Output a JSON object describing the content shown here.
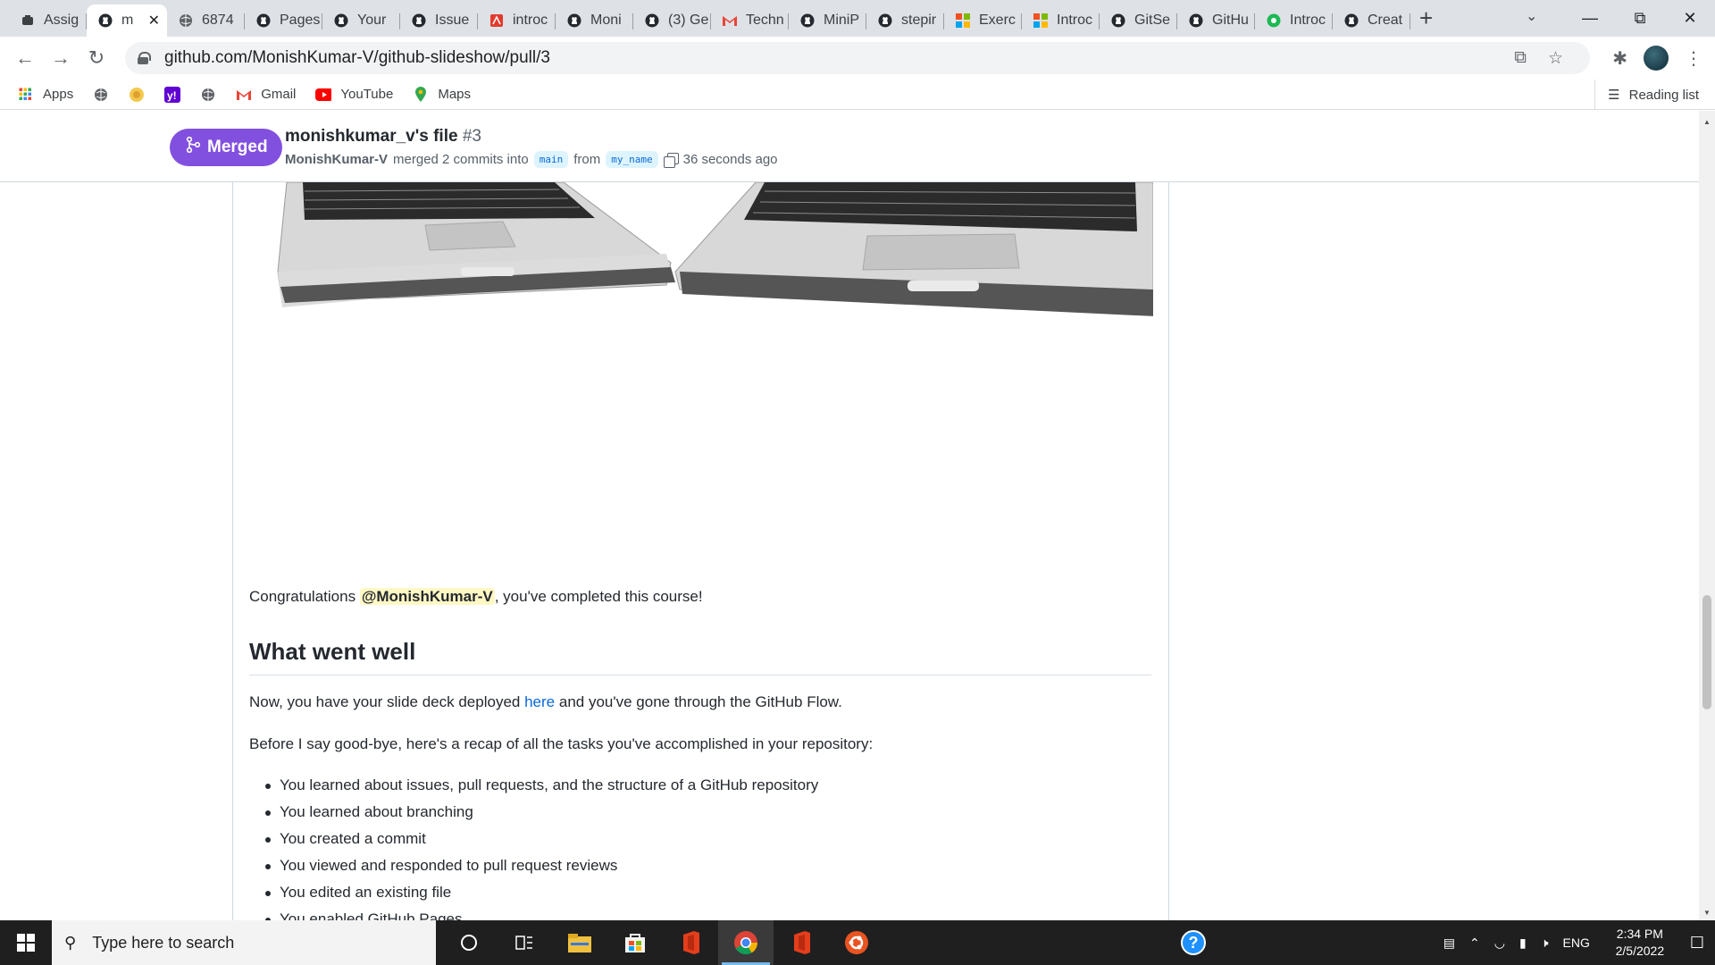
{
  "browser": {
    "tabs": [
      {
        "label": "Assig",
        "icon": "generic-app-icon"
      },
      {
        "label": "m",
        "icon": "github-icon",
        "active": true
      },
      {
        "label": "6874",
        "icon": "globe-icon"
      },
      {
        "label": "Pages",
        "icon": "github-icon"
      },
      {
        "label": "Your",
        "icon": "github-icon"
      },
      {
        "label": "Issue",
        "icon": "github-icon"
      },
      {
        "label": "introc",
        "icon": "pdf-icon"
      },
      {
        "label": "Moni",
        "icon": "github-icon"
      },
      {
        "label": "(3) Ge",
        "icon": "github-icon"
      },
      {
        "label": "Techn",
        "icon": "gmail-icon"
      },
      {
        "label": "MiniP",
        "icon": "github-icon"
      },
      {
        "label": "stepir",
        "icon": "github-icon"
      },
      {
        "label": "Exerc",
        "icon": "microsoft-icon"
      },
      {
        "label": "Introc",
        "icon": "microsoft-icon"
      },
      {
        "label": "GitSe",
        "icon": "github-icon"
      },
      {
        "label": "GitHu",
        "icon": "github-icon"
      },
      {
        "label": "Introc",
        "icon": "green-app-icon"
      },
      {
        "label": "Creat",
        "icon": "github-icon"
      }
    ],
    "new_tab": "+",
    "url": "github.com/MonishKumar-V/github-slideshow/pull/3",
    "bookmarks": [
      {
        "label": "Apps",
        "icon": "apps-grid-icon"
      },
      {
        "label": "",
        "icon": "globe-icon"
      },
      {
        "label": "",
        "icon": "emblem-icon"
      },
      {
        "label": "",
        "icon": "yahoo-icon"
      },
      {
        "label": "",
        "icon": "globe-icon"
      },
      {
        "label": "Gmail",
        "icon": "gmail-icon"
      },
      {
        "label": "YouTube",
        "icon": "youtube-icon"
      },
      {
        "label": "Maps",
        "icon": "maps-icon"
      }
    ],
    "reading_list": "Reading list"
  },
  "pr": {
    "status": "Merged",
    "title": "monishkumar_v's file",
    "number": "#3",
    "author": "MonishKumar-V",
    "merged_text": "merged 2 commits into",
    "base_branch": "main",
    "from_text": "from",
    "head_branch": "my_name",
    "time_ago": "36 seconds ago"
  },
  "comment": {
    "congrats_prefix": "Congratulations",
    "mention": "@MonishKumar-V",
    "congrats_suffix": ", you've completed this course!",
    "heading": "What went well",
    "para1_prefix": "Now, you have your slide deck deployed",
    "para1_link": "here",
    "para1_suffix": "and you've gone through the GitHub Flow.",
    "para2": "Before I say good-bye, here's a recap of all the tasks you've accomplished in your repository:",
    "tasks": [
      "You learned about issues, pull requests, and the structure of a GitHub repository",
      "You learned about branching",
      "You created a commit",
      "You viewed and responded to pull request reviews",
      "You edited an existing file",
      "You enabled GitHub Pages"
    ]
  },
  "taskbar": {
    "search_placeholder": "Type here to search",
    "language": "ENG",
    "time": "2:34 PM",
    "date": "2/5/2022"
  }
}
